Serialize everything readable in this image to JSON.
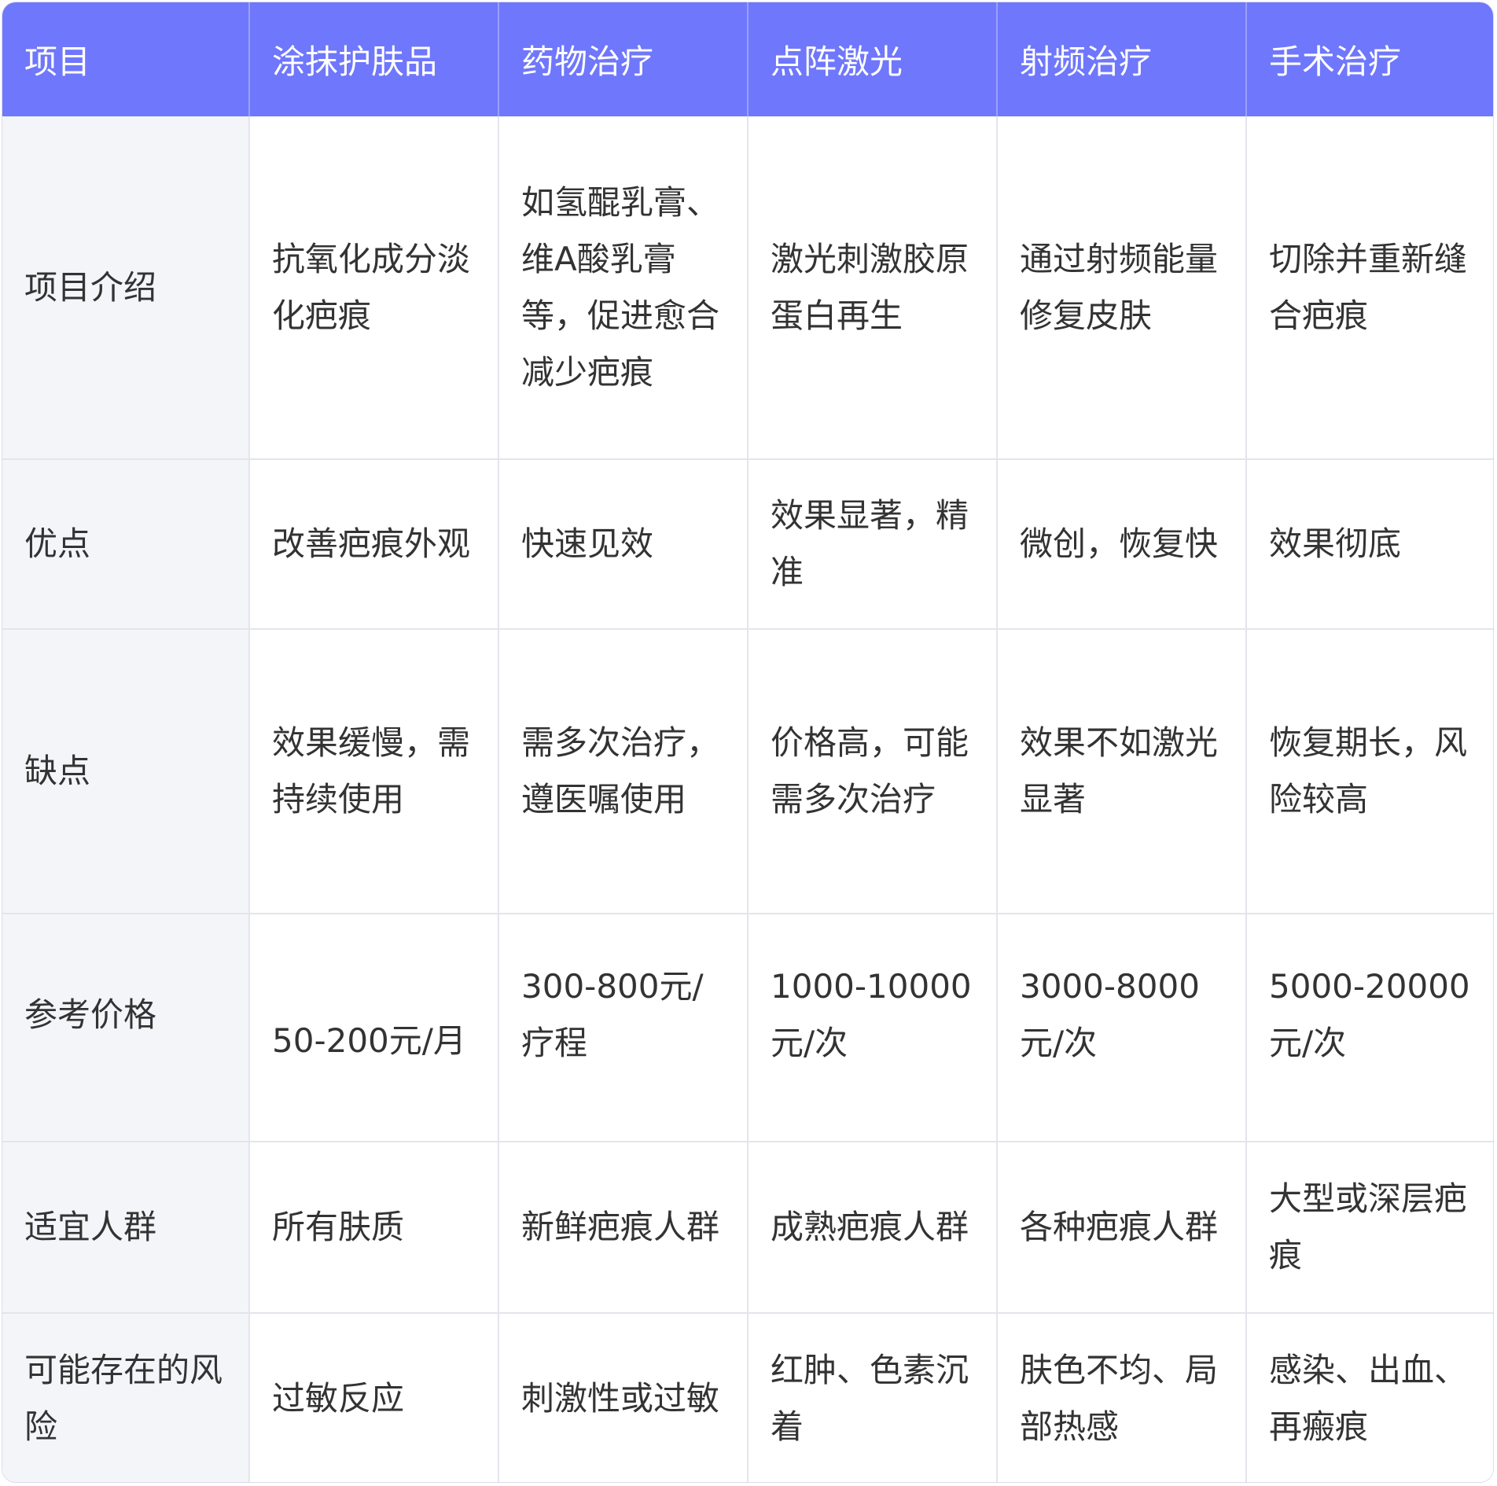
{
  "table": {
    "headers": [
      "项目",
      "涂抹护肤品",
      "药物治疗",
      "点阵激光",
      "射频治疗",
      "手术治疗"
    ],
    "rows": [
      {
        "label": "项目介绍",
        "cells": [
          "抗氧化成分淡化疤痕",
          "如氢醌乳膏、维A酸乳膏等，促进愈合减少疤痕",
          "激光刺激胶原蛋白再生",
          "通过射频能量修复皮肤",
          "切除并重新缝合疤痕"
        ]
      },
      {
        "label": "优点",
        "cells": [
          "改善疤痕外观",
          "快速见效",
          "效果显著，精准",
          "微创，恢复快",
          "效果彻底"
        ]
      },
      {
        "label": "缺点",
        "cells": [
          "效果缓慢，需持续使用",
          "需多次治疗，遵医嘱使用",
          "价格高，可能需多次治疗",
          "效果不如激光显著",
          "恢复期长，风险较高"
        ]
      },
      {
        "label": "参考价格",
        "cells": [
          "50-200元/月",
          "300-800元/疗程",
          "1000-10000元/次",
          "3000-8000元/次",
          "5000-20000元/次"
        ]
      },
      {
        "label": "适宜人群",
        "cells": [
          "所有肤质",
          "新鲜疤痕人群",
          "成熟疤痕人群",
          "各种疤痕人群",
          "大型或深层疤痕"
        ]
      },
      {
        "label": "可能存在的风险",
        "cells": [
          "过敏反应",
          "刺激性或过敏",
          "红肿、色素沉着",
          "肤色不均、局部热感",
          "感染、出血、再瘢痕"
        ]
      }
    ]
  },
  "colors": {
    "header_bg": "#6f77fc",
    "header_text": "#ffffff",
    "row_head_bg": "#f4f5f9",
    "border": "#e3e5ec",
    "text": "#333333"
  }
}
